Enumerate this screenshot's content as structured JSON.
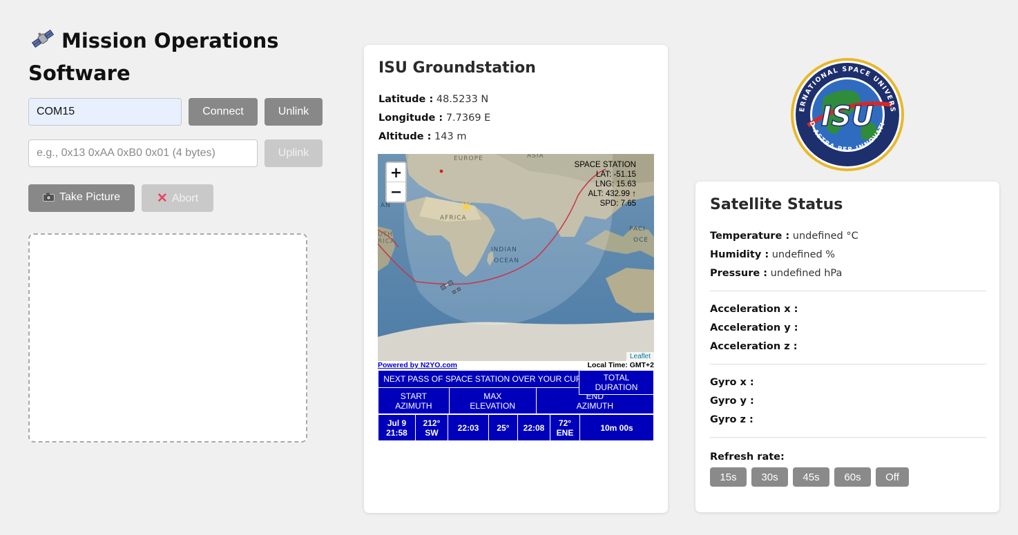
{
  "header": {
    "title_line1": "Mission Operations",
    "title_line2": "Software",
    "title_icon": "satellite-icon"
  },
  "connection": {
    "port_value": "COM15",
    "connect_label": "Connect",
    "unlink_label": "Unlink"
  },
  "uplink": {
    "placeholder": "e.g., 0x13 0xAA 0xB0 0x01 (4 bytes)",
    "uplink_label": "Uplink"
  },
  "camera": {
    "take_picture_label": "Take Picture",
    "take_picture_icon": "camera-icon",
    "abort_label": "Abort",
    "abort_icon": "cross-mark-icon"
  },
  "groundstation": {
    "title": "ISU Groundstation",
    "latitude_label": "Latitude :",
    "latitude_value": "48.5233 N",
    "longitude_label": "Longitude :",
    "longitude_value": "7.7369 E",
    "altitude_label": "Altitude :",
    "altitude_value": "143 m"
  },
  "map": {
    "zoom_in": "+",
    "zoom_out": "−",
    "labels": {
      "europe": "EUROPE",
      "asia": "ASIA",
      "africa": "AFRICA",
      "indian_ocean_1": "INDIAN",
      "indian_ocean_2": "OCEAN",
      "south_america_1": "UTH",
      "south_america_2": "RICA",
      "pacific_1": "PACI",
      "pacific_2": "OCE",
      "atlantic_fragment": "AN"
    },
    "station": {
      "name": "SPACE STATION",
      "lat": "LAT: -51.15",
      "lng": "LNG: 15.63",
      "alt": "ALT: 432.99 ↑",
      "spd": "SPD: 7.65"
    },
    "attribution": "Leaflet",
    "powered_by": "Powered by N2YO.com",
    "local_time": "Local Time: GMT+2"
  },
  "next_pass": {
    "heading": "NEXT PASS OF SPACE STATION OVER YOUR CURRENT LOCATION",
    "col_start_1": "START",
    "col_start_2": "AZIMUTH",
    "col_max_1": "MAX",
    "col_max_2": "ELEVATION",
    "col_end_1": "END",
    "col_end_2": "AZIMUTH",
    "col_total_1": "TOTAL",
    "col_total_2": "DURATION",
    "start_date": "Jul 9",
    "start_time": "21:58",
    "start_az_deg": "212°",
    "start_az_dir": "SW",
    "max_time": "22:03",
    "max_elev": "25°",
    "end_time": "22:08",
    "end_az_deg": "72°",
    "end_az_dir": "ENE",
    "duration": "10m 00s"
  },
  "logo": {
    "ring_text_top": "INTERNATIONAL SPACE UNIVERSITY",
    "ring_text_bottom": "AD ASTRA PER INNOVATIO",
    "center_text": "ISU"
  },
  "status": {
    "title": "Satellite Status",
    "temperature_label": "Temperature :",
    "temperature_value": "undefined °C",
    "humidity_label": "Humidity :",
    "humidity_value": "undefined %",
    "pressure_label": "Pressure :",
    "pressure_value": "undefined hPa",
    "accel_x_label": "Acceleration x :",
    "accel_y_label": "Acceleration y :",
    "accel_z_label": "Acceleration z :",
    "gyro_x_label": "Gyro x :",
    "gyro_y_label": "Gyro y :",
    "gyro_z_label": "Gyro z :",
    "refresh_label": "Refresh rate:",
    "refresh_options": [
      "15s",
      "30s",
      "45s",
      "60s",
      "Off"
    ]
  },
  "colors": {
    "page_bg": "#f0f0f0",
    "button_gray": "#888888",
    "button_disabled": "#c9c9c9",
    "pass_table_blue": "#0000bb",
    "track_red": "#c8374a"
  }
}
